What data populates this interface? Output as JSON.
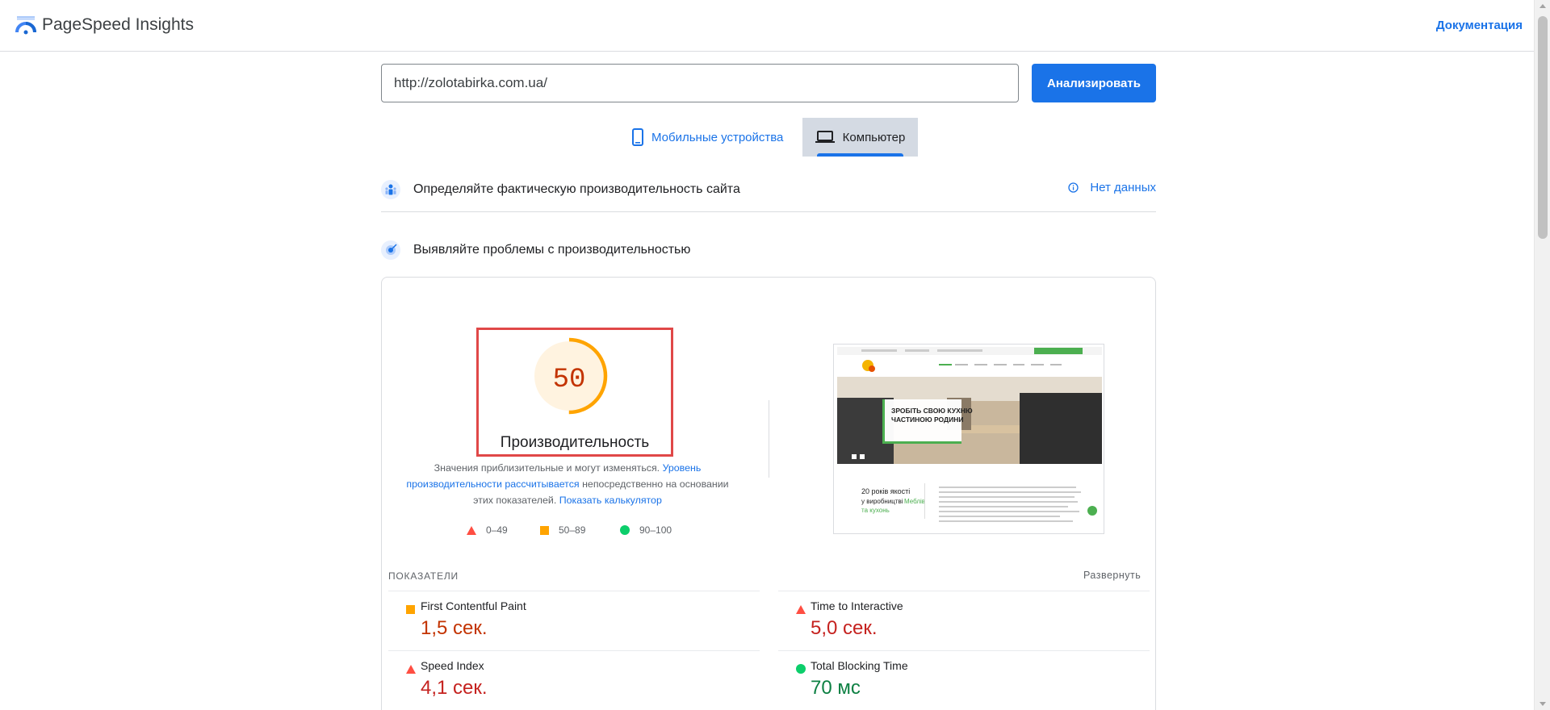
{
  "header": {
    "app_title": "PageSpeed Insights",
    "docs_link": "Документация"
  },
  "url_form": {
    "url_value": "http://zolotabirka.com.ua/",
    "analyze_label": "Анализировать"
  },
  "device_tabs": [
    {
      "label": "Мобильные устройства",
      "selected": false
    },
    {
      "label": "Компьютер",
      "selected": true
    }
  ],
  "field_data": {
    "title": "Определяйте фактическую производительность сайта",
    "no_data_label": "Нет данных"
  },
  "lab_data": {
    "title": "Выявляйте проблемы с производительностью"
  },
  "score": {
    "value": "50",
    "fraction": 0.5,
    "label": "Производительность",
    "color": "#ffa400"
  },
  "description": {
    "part1": "Значения приблизительные и могут изменяться. ",
    "link1": "Уровень производительности рассчитывается",
    "part2": " непосредственно на основании этих показателей. ",
    "link2": "Показать калькулятор"
  },
  "legend": [
    {
      "range": "0–49",
      "shape": "triangle",
      "color": "#ff4e42"
    },
    {
      "range": "50–89",
      "shape": "square",
      "color": "#ffa400"
    },
    {
      "range": "90–100",
      "shape": "circle",
      "color": "#0cce6b"
    }
  ],
  "screenshot": {
    "heading_line1": "ЗРОБІТЬ СВОЮ КУХНЮ",
    "heading_line2": "ЧАСТИНОЮ РОДИНИ",
    "years_line1": "20 років якості",
    "years_line2": "у виробництві",
    "years_line3": "Меблів",
    "years_line4": "та кухонь"
  },
  "metrics_section": {
    "label": "ПОКАЗАТЕЛИ",
    "expand_label": "Развернуть"
  },
  "metrics": [
    {
      "name": "First Contentful Paint",
      "value": "1,5 сек.",
      "status": "average"
    },
    {
      "name": "Time to Interactive",
      "value": "5,0 сек.",
      "status": "fail"
    },
    {
      "name": "Speed Index",
      "value": "4,1 сек.",
      "status": "fail"
    },
    {
      "name": "Total Blocking Time",
      "value": "70 мс",
      "status": "pass"
    }
  ]
}
